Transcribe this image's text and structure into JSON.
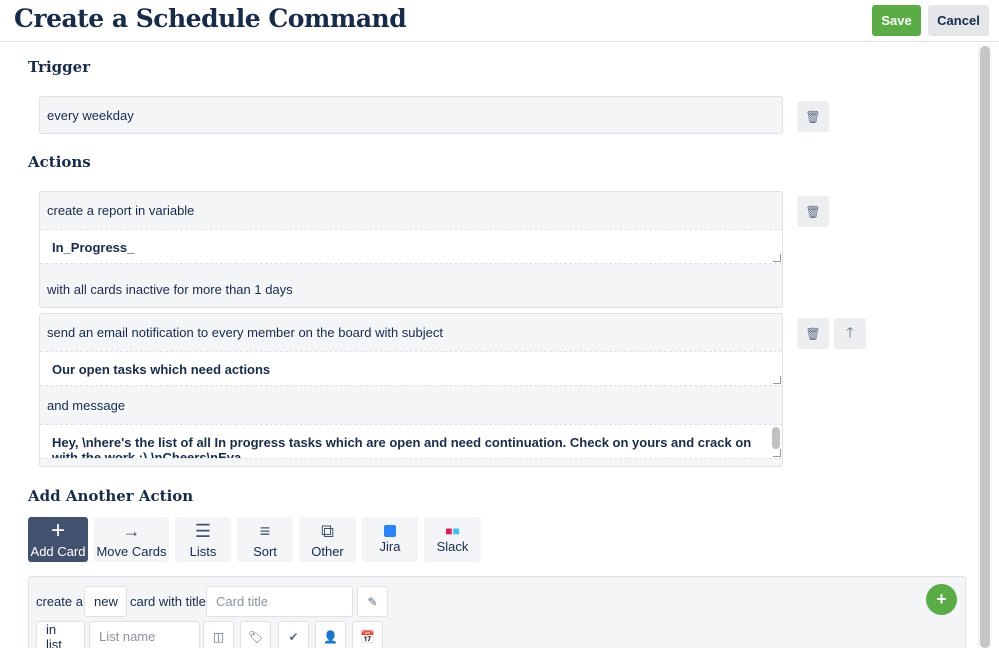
{
  "header": {
    "title": "Create a Schedule Command",
    "save_label": "Save",
    "cancel_label": "Cancel"
  },
  "trigger": {
    "heading": "Trigger",
    "text": "every weekday"
  },
  "actions": {
    "heading": "Actions",
    "report": {
      "line1": "create a report in variable",
      "variable": "In_Progress_",
      "line2": "with all cards inactive for more than 1 days"
    },
    "email": {
      "line1": "send an email notification to every member on the board with subject",
      "subject": "Our open tasks which need actions",
      "line2": "and message",
      "message": "Hey, \\nhere's the list of all In progress tasks which are open and need continuation. Check on yours and crack on with the work :) \\nCheers\\nEva"
    }
  },
  "add_action": {
    "heading": "Add Another Action",
    "buttons": [
      {
        "label": "Add Card",
        "icon": "plus-icon"
      },
      {
        "label": "Move Cards",
        "icon": "arrow-right-icon"
      },
      {
        "label": "Lists",
        "icon": "list-icon"
      },
      {
        "label": "Sort",
        "icon": "sort-icon"
      },
      {
        "label": "Other",
        "icon": "copy-icon"
      },
      {
        "label": "Jira",
        "icon": "jira-icon"
      },
      {
        "label": "Slack",
        "icon": "slack-icon"
      }
    ]
  },
  "card_builder": {
    "create_a": "create a",
    "new_value": "new",
    "card_with_title": "card with title",
    "title_placeholder": "Card title",
    "in_list": "in list",
    "list_placeholder": "List name"
  },
  "colors": {
    "primary": "#5aac44",
    "text": "#172b4d",
    "active_tab": "#42526e"
  }
}
